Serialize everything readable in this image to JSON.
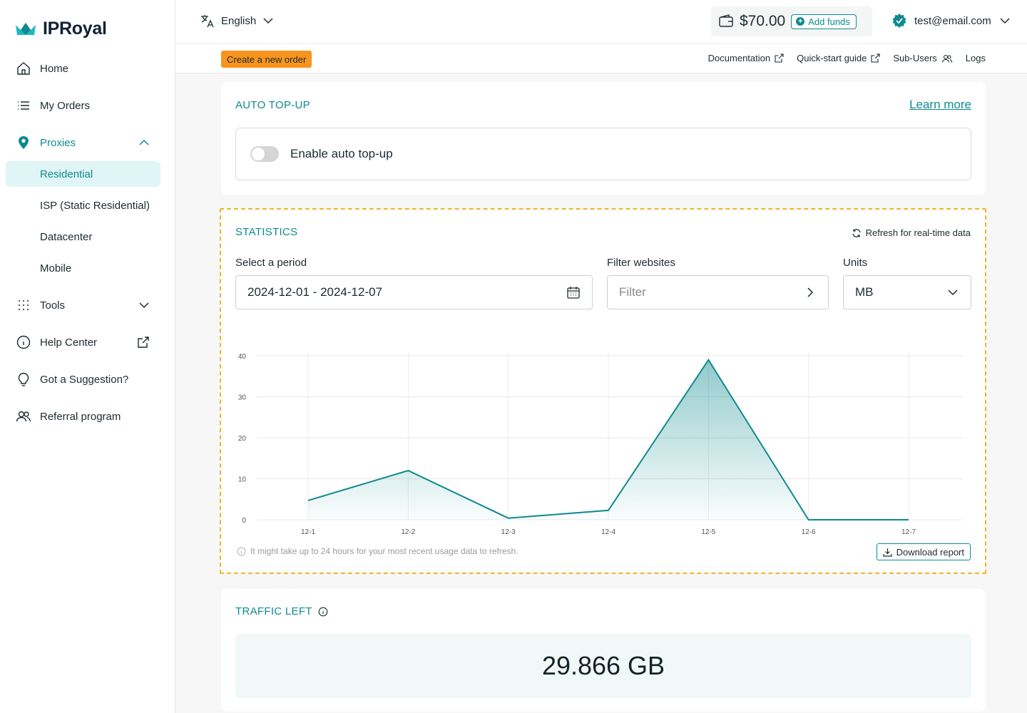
{
  "brand": {
    "name": "IPRoyal",
    "accent": "#0e8a8f",
    "warning": "#f7941d"
  },
  "sidebar": {
    "items": [
      {
        "label": "Home",
        "icon": "home-icon"
      },
      {
        "label": "My Orders",
        "icon": "list-icon"
      },
      {
        "label": "Proxies",
        "icon": "location-pin-icon",
        "expanded": true
      },
      {
        "label": "Tools",
        "icon": "grid-dots-icon",
        "expanded": false
      },
      {
        "label": "Help Center",
        "icon": "info-circle-icon"
      },
      {
        "label": "Got a Suggestion?",
        "icon": "lightbulb-icon"
      },
      {
        "label": "Referral program",
        "icon": "users-icon"
      }
    ],
    "proxies_sub": [
      {
        "label": "Residential",
        "selected": true
      },
      {
        "label": "ISP (Static Residential)"
      },
      {
        "label": "Datacenter"
      },
      {
        "label": "Mobile"
      }
    ]
  },
  "header": {
    "language": "English",
    "balance": "$70.00",
    "add_funds": "Add funds",
    "user_email": "test@email.com"
  },
  "subheader": {
    "create_order": "Create a new order",
    "links": [
      "Documentation",
      "Quick-start guide",
      "Sub-Users",
      "Logs"
    ]
  },
  "auto_topup": {
    "title": "AUTO TOP-UP",
    "learn_more": "Learn more",
    "toggle_label": "Enable auto top-up",
    "enabled": false
  },
  "statistics": {
    "title": "STATISTICS",
    "refresh": "Refresh for real-time data",
    "period_label": "Select a period",
    "period_value": "2024-12-01 - 2024-12-07",
    "filter_label": "Filter websites",
    "filter_placeholder": "Filter",
    "units_label": "Units",
    "units_value": "MB",
    "note": "It might take up to 24 hours for your most recent usage data to refresh.",
    "download": "Download report"
  },
  "chart_data": {
    "type": "area",
    "categories": [
      "12-1",
      "12-2",
      "12-3",
      "12-4",
      "12-5",
      "12-6",
      "12-7"
    ],
    "values": [
      4.7,
      12,
      0.4,
      2.3,
      39,
      0,
      0
    ],
    "yticks": [
      0,
      10,
      20,
      30,
      40
    ],
    "ylim": [
      0,
      40
    ],
    "grid": true,
    "color": "#0e8a8f"
  },
  "traffic_left": {
    "title": "TRAFFIC LEFT",
    "value": "29.866 GB"
  }
}
